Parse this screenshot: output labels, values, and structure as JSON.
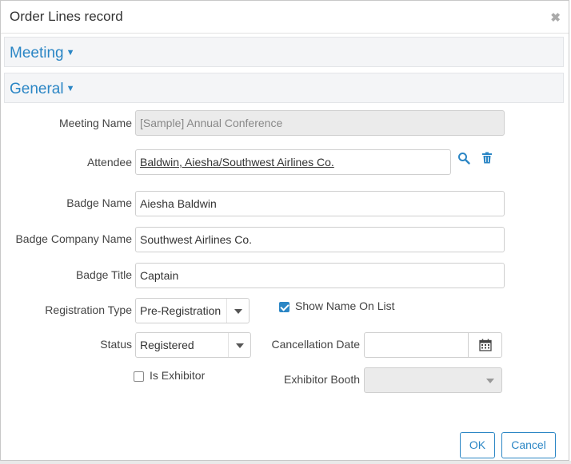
{
  "dialog": {
    "title": "Order Lines record",
    "close_glyph": "✖"
  },
  "sections": {
    "meeting": "Meeting",
    "general": "General",
    "caret": "▼"
  },
  "form": {
    "meeting_name": {
      "label": "Meeting Name",
      "value": "[Sample] Annual Conference"
    },
    "attendee": {
      "label": "Attendee",
      "value": "Baldwin, Aiesha/Southwest Airlines Co."
    },
    "badge_name": {
      "label": "Badge Name",
      "value": "Aiesha Baldwin"
    },
    "badge_company_name": {
      "label": "Badge Company Name",
      "value": "Southwest Airlines Co."
    },
    "badge_title": {
      "label": "Badge Title",
      "value": "Captain"
    },
    "registration_type": {
      "label": "Registration Type",
      "value": "Pre-Registration"
    },
    "show_name_on_list": {
      "label": "Show Name On List",
      "checked": true
    },
    "status": {
      "label": "Status",
      "value": "Registered"
    },
    "cancellation_date": {
      "label": "Cancellation Date",
      "value": ""
    },
    "is_exhibitor": {
      "label": "Is Exhibitor",
      "checked": false
    },
    "exhibitor_booth": {
      "label": "Exhibitor Booth",
      "value": ""
    }
  },
  "buttons": {
    "ok": "OK",
    "cancel": "Cancel"
  },
  "colors": {
    "accent": "#2b86c5",
    "section_bg": "#f4f5f7",
    "disabled_bg": "#ebebeb"
  },
  "icons": {
    "search": "search-icon",
    "delete": "trash-icon",
    "calendar": "calendar-icon"
  }
}
